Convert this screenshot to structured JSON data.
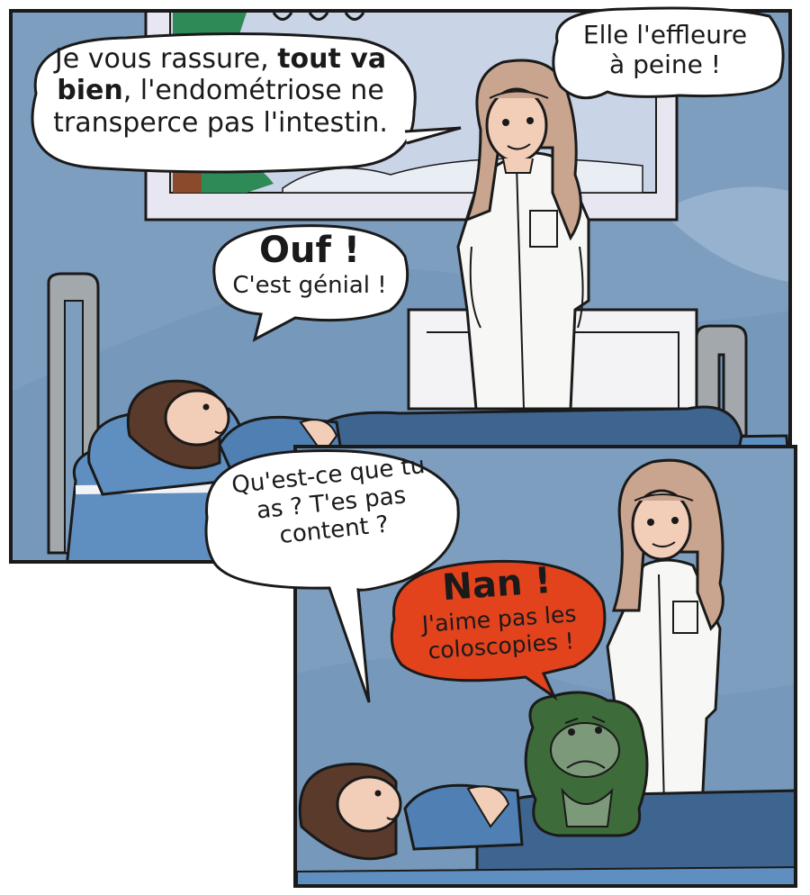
{
  "colors": {
    "wall": "#7d9ebf",
    "wall_light": "#9db7d2",
    "blanket": "#3e6590",
    "scrubs": "#f7f7f5",
    "hair_doctor": "#c9a58f",
    "hair_patient": "#5a3a2b",
    "skin": "#f2cdb8",
    "shirt_patient": "#4f7fb3",
    "creature": "#3e6b3a",
    "red_bubble": "#e2421c",
    "ink": "#1a1a1a"
  },
  "panel1": {
    "doctor_speech": {
      "before": "Je vous rassure, ",
      "bold": "tout va bien",
      "after": ", l'endométriose ne transperce pas l'intestin."
    },
    "narration": {
      "line1": "Elle l'effleure",
      "line2": "à peine !"
    },
    "patient_reply": {
      "line1": "Ouf !",
      "line2": "C'est génial !"
    }
  },
  "panel2": {
    "doctor_question": {
      "line1": "Qu'est-ce que tu",
      "line2": "as ? T'es pas",
      "line3": "content ?"
    },
    "creature_reply": {
      "line1": "Nan !",
      "line2": "J'aime pas les",
      "line3": "coloscopies !"
    }
  }
}
